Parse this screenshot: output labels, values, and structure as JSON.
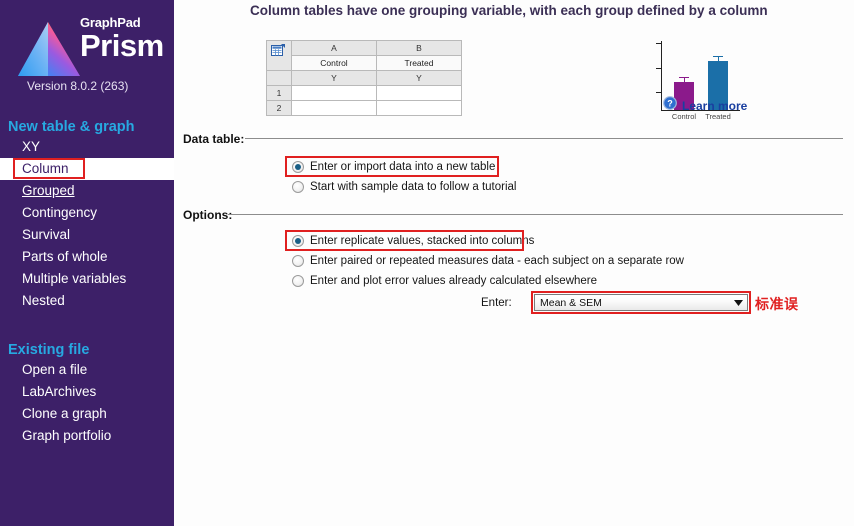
{
  "colors": {
    "sidebar_bg": "#3d2068",
    "nav_header": "#27a9e1",
    "highlight_red": "#e02020",
    "link_blue": "#1a3fa0",
    "bar_control": "#8b1a8b",
    "bar_treated": "#1b6fa8",
    "headline": "#3b2f55"
  },
  "sidebar": {
    "brand": {
      "graphpad": "GraphPad",
      "prism": "Prism",
      "version": "Version 8.0.2 (263)",
      "logo_icon": "prism-triangle-icon"
    },
    "sections": [
      {
        "header": "New table & graph",
        "items": [
          {
            "label": "XY",
            "selected": false,
            "underlined": false
          },
          {
            "label": "Column",
            "selected": true,
            "underlined": false,
            "highlighted": true
          },
          {
            "label": "Grouped",
            "selected": false,
            "underlined": true
          },
          {
            "label": "Contingency",
            "selected": false,
            "underlined": false
          },
          {
            "label": "Survival",
            "selected": false,
            "underlined": false
          },
          {
            "label": "Parts of whole",
            "selected": false,
            "underlined": false
          },
          {
            "label": "Multiple variables",
            "selected": false,
            "underlined": false
          },
          {
            "label": "Nested",
            "selected": false,
            "underlined": false
          }
        ]
      },
      {
        "header": "Existing file",
        "items": [
          {
            "label": "Open a file",
            "selected": false,
            "underlined": false
          },
          {
            "label": "LabArchives",
            "selected": false,
            "underlined": false
          },
          {
            "label": "Clone a graph",
            "selected": false,
            "underlined": false
          },
          {
            "label": "Graph portfolio",
            "selected": false,
            "underlined": false
          }
        ]
      }
    ]
  },
  "main": {
    "headline": "Column tables have one grouping variable, with each group defined by a column",
    "sheet": {
      "corner_icon": "table-sheet-icon",
      "column_headers": [
        "A",
        "B"
      ],
      "group_titles": [
        "Control",
        "Treated"
      ],
      "sub_headers": [
        "Y",
        "Y"
      ],
      "row_numbers": [
        "1",
        "2"
      ],
      "cells": [
        [
          "",
          ""
        ],
        [
          "",
          ""
        ]
      ]
    },
    "learn_more": {
      "icon": "help-question-icon",
      "label": "Learn more"
    },
    "data_table": {
      "label": "Data table:",
      "options": [
        {
          "label": "Enter or import data into a new table",
          "selected": true,
          "highlighted": true
        },
        {
          "label": "Start with sample data to follow a tutorial",
          "selected": false,
          "highlighted": false
        }
      ]
    },
    "options": {
      "label": "Options:",
      "choices": [
        {
          "label": "Enter replicate values, stacked into columns",
          "selected": true,
          "highlighted": true
        },
        {
          "label": "Enter paired or repeated measures data - each subject on a separate row",
          "selected": false,
          "highlighted": false
        },
        {
          "label": "Enter and plot error values already calculated elsewhere",
          "selected": false,
          "highlighted": false
        }
      ],
      "enter_label": "Enter:",
      "enter_value": "Mean & SEM",
      "dropdown_icon": "chevron-down-icon",
      "annotation": "标准误"
    }
  },
  "chart_data": {
    "type": "bar",
    "categories": [
      "Control",
      "Treated"
    ],
    "values": [
      40,
      70
    ],
    "errors": [
      6,
      5
    ],
    "colors": [
      "#8b1a8b",
      "#1b6fa8"
    ],
    "title": "",
    "xlabel": "",
    "ylabel": "",
    "ylim": [
      0,
      100
    ],
    "grid": false,
    "legend": "none",
    "ticks": 3
  }
}
